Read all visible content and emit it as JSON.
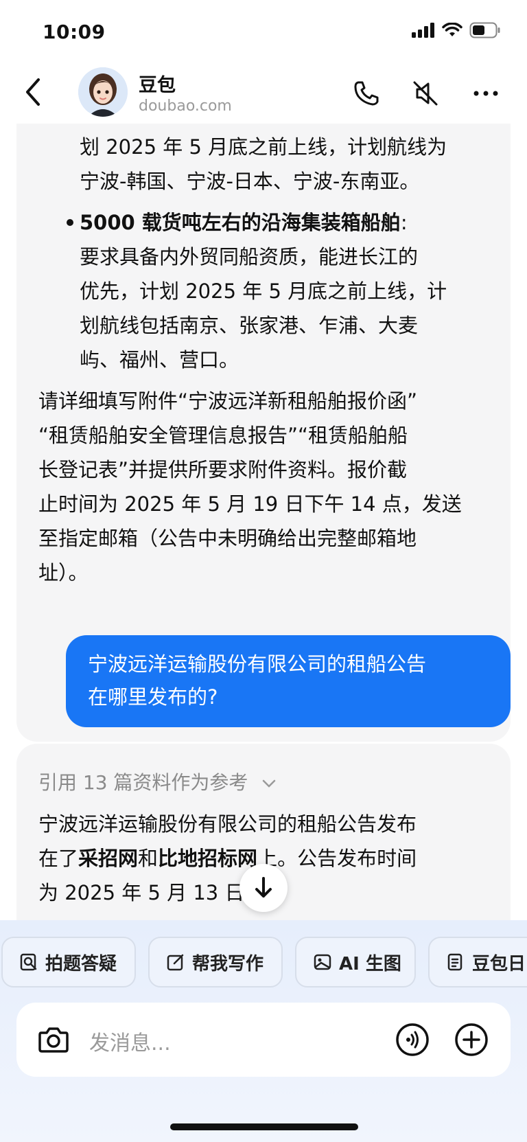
{
  "status_bar": {
    "time": "10:09"
  },
  "header": {
    "name": "豆包",
    "domain": "doubao.com"
  },
  "bot_message_1": {
    "lines": [
      "划 2025 年 5 月底之前上线，计划航线为",
      "宁波-韩国、宁波-日本、宁波-东南亚。"
    ],
    "bullet_bold": "5000 载货吨左右的沿海集装箱船舶",
    "bullet_colon": ":",
    "bullet_lines": [
      "要求具备内外贸同船资质，能进长江的",
      "优先，计划 2025 年 5 月底之前上线，计",
      "划航线包括南京、张家港、乍浦、大麦",
      "屿、福州、营口。"
    ],
    "para_lines": [
      "请详细填写附件“宁波远洋新租船舶报价函”",
      "“租赁船舶安全管理信息报告”“租赁船舶船",
      "长登记表”并提供所要求附件资料。报价截",
      "止时间为 2025 年 5 月 19 日下午 14 点，发送",
      "至指定邮箱（公告中未明确给出完整邮箱地",
      "址）。"
    ]
  },
  "user_message": {
    "lines": [
      "宁波远洋运输股份有限公司的租船公告",
      "在哪里发布的?"
    ]
  },
  "bot_message_2": {
    "reference": "引用 13 篇资料作为参考",
    "line1": "宁波远洋运输股份有限公司的租船公告发布",
    "line2_a": "在了",
    "line2_b": "采招网",
    "line2_c": "和",
    "line2_d": "比地招标网",
    "line2_e": "上。公告发布时间",
    "line3": "为 2025 年 5 月 13 日。"
  },
  "chips": [
    {
      "label": "拍题答疑",
      "icon": "scan-question-icon"
    },
    {
      "label": "帮我写作",
      "icon": "edit-icon"
    },
    {
      "label": "AI 生图",
      "icon": "image-icon"
    },
    {
      "label": "豆包日",
      "icon": "doc-icon"
    }
  ],
  "input": {
    "placeholder": "发消息..."
  },
  "colors": {
    "user_bubble": "#1976f5",
    "bot_bubble": "#f5f5f6"
  }
}
